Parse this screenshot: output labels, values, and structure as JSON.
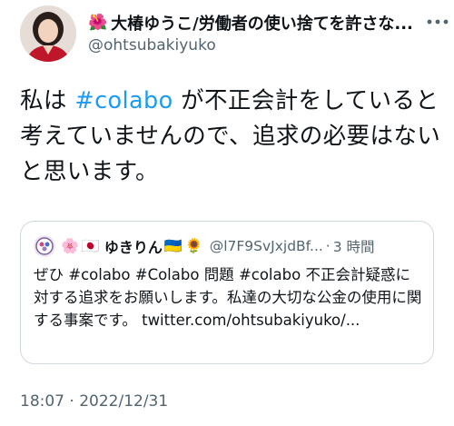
{
  "author": {
    "flag_emoji": "🌺",
    "display_name": "大椿ゆうこ/労働者の使い捨てを許さな...",
    "handle": "@ohtsubakiyuko"
  },
  "tweet": {
    "text_part1": "私は ",
    "hashtag": "#colabo",
    "text_part2": " が不正会計をしていると考えていませんので、追求の必要はないと思います。"
  },
  "quote": {
    "emoji_1": "🌸",
    "emoji_2": "🇯🇵",
    "name": "ゆきりん",
    "emoji_3": "🇺🇦",
    "emoji_4": "🌻",
    "handle": "@l7F9SvJxjdBf...",
    "dot": "·",
    "time": "3 時間",
    "text": "ぜひ #colabo #Colabo 問題 #colabo 不正会計疑惑に対する追求をお願いします。私達の大切な公金の使用に関する事案です。 twitter.com/ohtsubakiyuko/..."
  },
  "timestamp": "18:07 · 2022/12/31",
  "colors": {
    "hashtag": "#1d9bf0",
    "secondary_text": "#536471",
    "border": "#cfd9de"
  }
}
